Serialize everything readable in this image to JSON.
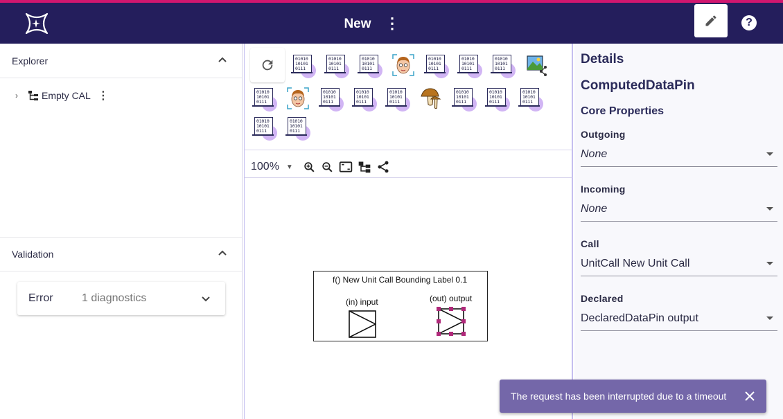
{
  "header": {
    "title": "New",
    "icons": {
      "logo": "sparkle-logo-icon",
      "menu": "more-vert-icon",
      "edit": "pencil-icon",
      "help": "help-icon"
    },
    "colors": {
      "stripe": "#d1166f",
      "bar": "#241e5c"
    }
  },
  "explorer": {
    "title": "Explorer",
    "tree": [
      {
        "label": "Empty CAL"
      }
    ]
  },
  "validation": {
    "title": "Validation",
    "diagnostic": {
      "level": "Error",
      "count_text": "1 diagnostics"
    }
  },
  "palette": {
    "items": [
      "binary-data-icon",
      "binary-data-icon",
      "binary-data-icon",
      "avatar-face-icon",
      "binary-data-icon",
      "binary-data-icon",
      "binary-data-icon",
      "image-share-icon",
      "binary-data-icon",
      "avatar-face-icon",
      "binary-data-icon",
      "binary-data-icon",
      "binary-data-icon",
      "mushroom-icon",
      "binary-data-icon",
      "binary-data-icon",
      "binary-data-icon",
      "binary-data-icon",
      "binary-data-icon"
    ],
    "binary_text": [
      "01010",
      "10101",
      "0111"
    ]
  },
  "toolbar": {
    "zoom": "100%"
  },
  "diagram": {
    "label": "New Unit Call Bounding Label 0.1",
    "func_symbol": "f()",
    "pin_in": "(in) input",
    "pin_out": "(out) output",
    "selection_color": "#b0287a"
  },
  "details": {
    "title": "Details",
    "element": "ComputedDataPin",
    "section": "Core Properties",
    "fields": [
      {
        "label": "Outgoing",
        "value": "None"
      },
      {
        "label": "Incoming",
        "value": "None"
      },
      {
        "label": "Call",
        "value": "UnitCall New Unit Call"
      },
      {
        "label": "Declared",
        "value": "DeclaredDataPin output"
      }
    ]
  },
  "snackbar": {
    "message": "The request has been interrupted due to a timeout"
  }
}
